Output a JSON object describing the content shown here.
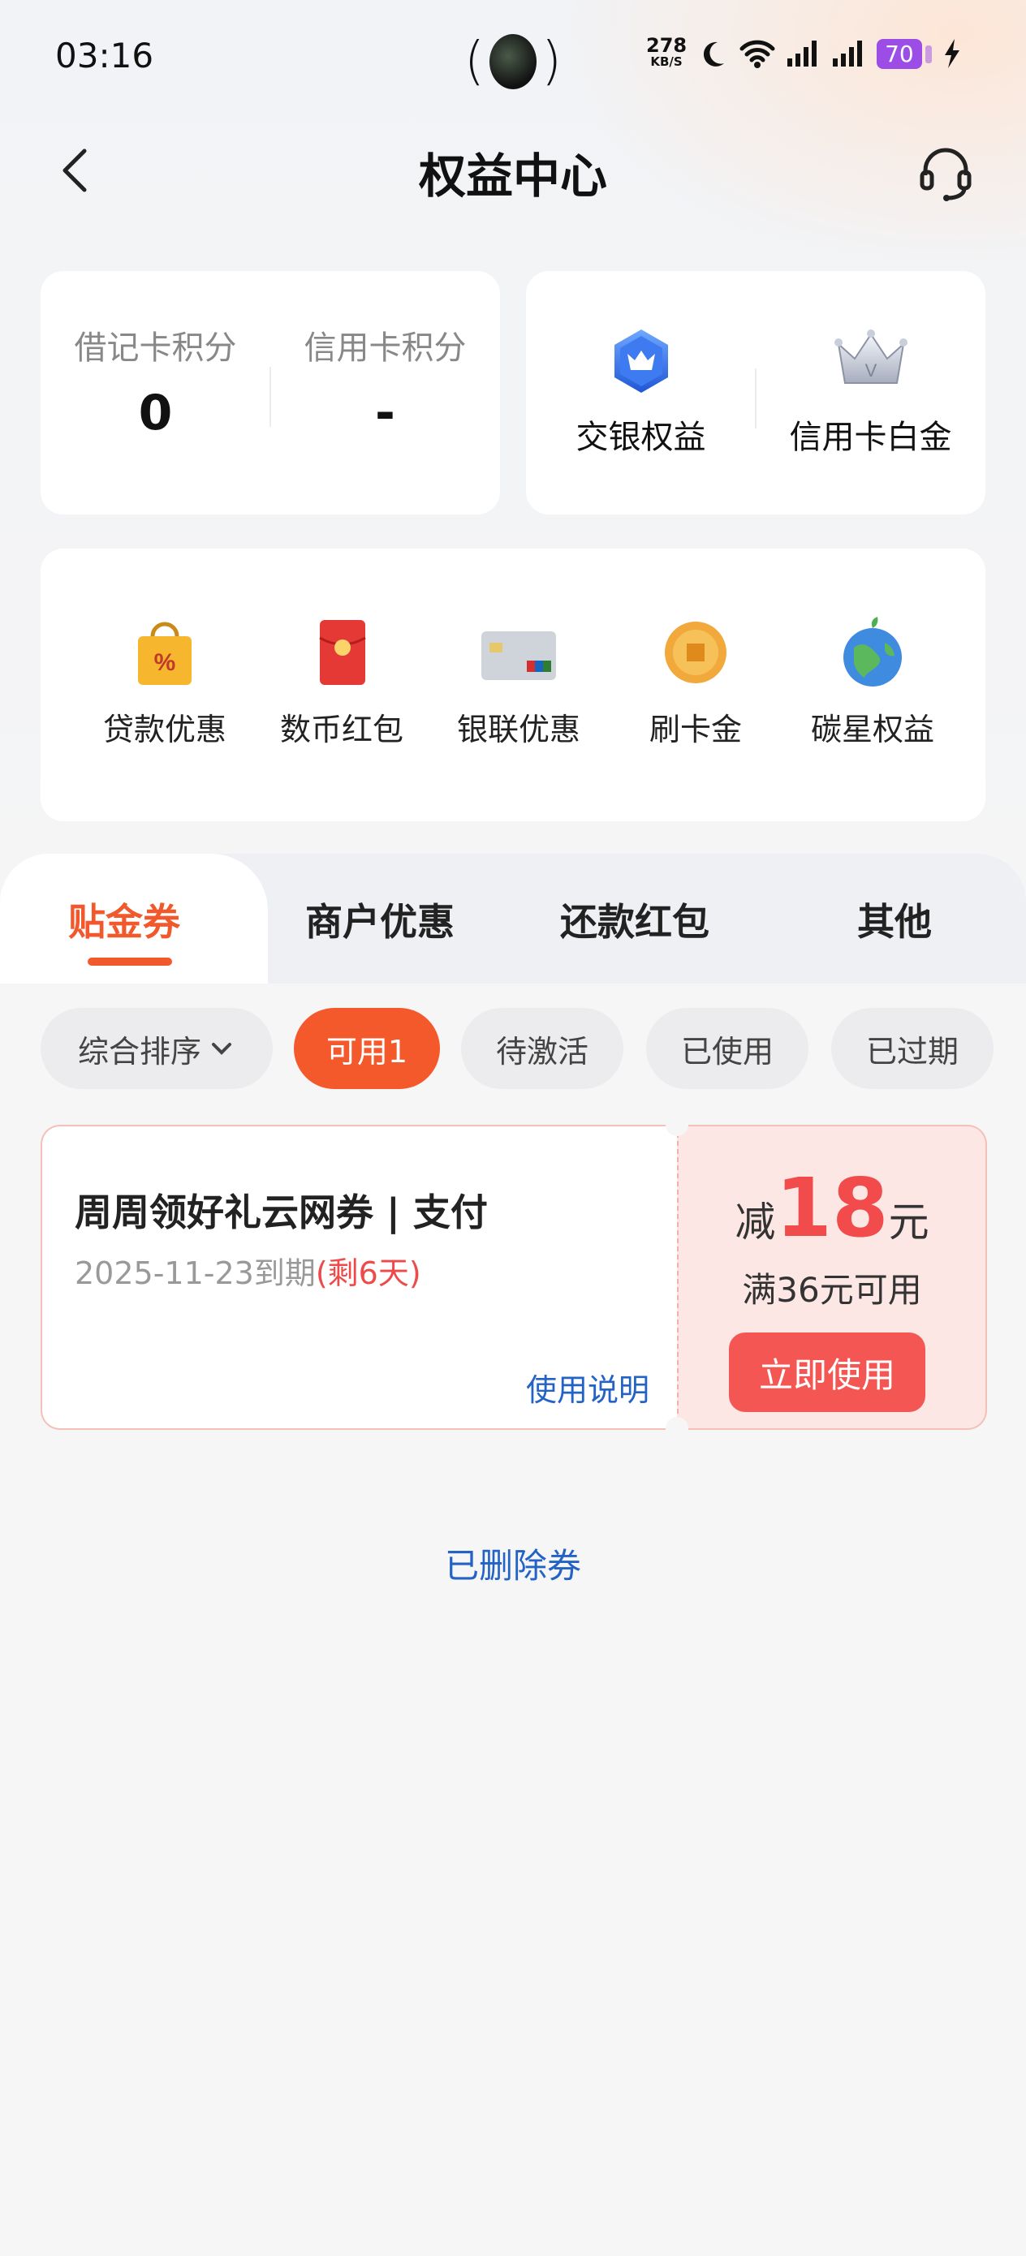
{
  "status_bar": {
    "time": "03:16",
    "net_speed": "278",
    "net_unit": "KB/S",
    "battery": "70"
  },
  "header": {
    "title": "权益中心"
  },
  "points": {
    "debit_label": "借记卡积分",
    "debit_value": "0",
    "credit_label": "信用卡积分",
    "credit_value": "-"
  },
  "membership": {
    "items": [
      {
        "label": "交银权益",
        "icon": "blue-crown-badge-icon"
      },
      {
        "label": "信用卡白金",
        "icon": "silver-crown-icon"
      }
    ]
  },
  "quick_links": [
    {
      "label": "贷款优惠",
      "icon": "shopping-bag-percent-icon"
    },
    {
      "label": "数币红包",
      "icon": "red-envelope-icon"
    },
    {
      "label": "银联优惠",
      "icon": "unionpay-card-icon"
    },
    {
      "label": "刷卡金",
      "icon": "gold-coin-icon"
    },
    {
      "label": "碳星权益",
      "icon": "globe-icon"
    }
  ],
  "tabs": [
    "贴金券",
    "商户优惠",
    "还款红包",
    "其他"
  ],
  "filters": {
    "sort": "综合排序",
    "chips": [
      "可用1",
      "待激活",
      "已使用",
      "已过期"
    ]
  },
  "coupon": {
    "title": "周周领好礼云网券 | 支付",
    "expire": "2025-11-23到期",
    "remain": "(剩6天)",
    "desc_link": "使用说明",
    "prefix": "减",
    "amount": "18",
    "unit": "元",
    "condition": "满36元可用",
    "button": "立即使用"
  },
  "footer": {
    "deleted_link": "已删除券"
  },
  "colors": {
    "accent": "#f1582c",
    "link": "#2363c6",
    "coupon_red": "#f24b4b"
  }
}
